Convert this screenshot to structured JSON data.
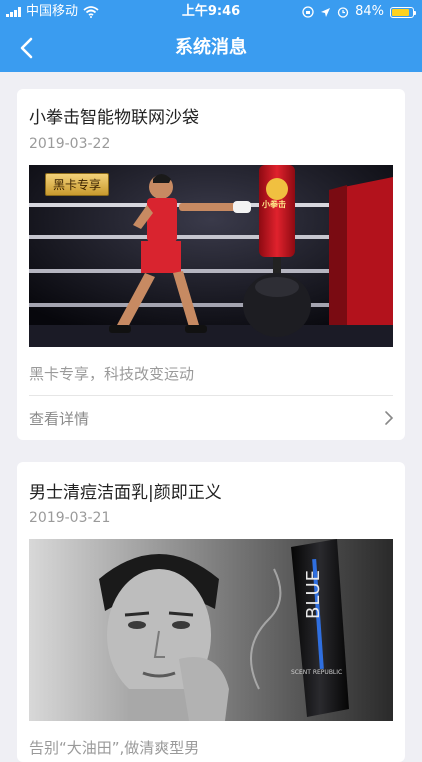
{
  "status_bar": {
    "carrier": "中国移动",
    "time": "上午9:46",
    "battery": "84%",
    "battery_level": 0.84,
    "icons": [
      "signal-icon",
      "wifi-icon",
      "screen-lock-icon",
      "location-icon",
      "alarm-icon",
      "battery-icon"
    ]
  },
  "nav": {
    "title": "系统消息",
    "back_icon": "chevron-left-icon"
  },
  "colors": {
    "header_bg": "#3a9cf0",
    "page_bg": "#efeff4",
    "battery_fill": "#ffd21f"
  },
  "messages": [
    {
      "title": "小拳击智能物联网沙袋",
      "date": "2019-03-22",
      "badge": "黑卡专享",
      "bag_logo": "小拳击",
      "description": "黑卡专享，科技改变运动",
      "detail_label": "查看详情"
    },
    {
      "title": "男士清痘洁面乳|颜即正义",
      "date": "2019-03-21",
      "product_text": "BLUE",
      "product_brand": "SCENT REPUBLIC",
      "description": "告别“大油田”,做清爽型男"
    }
  ]
}
